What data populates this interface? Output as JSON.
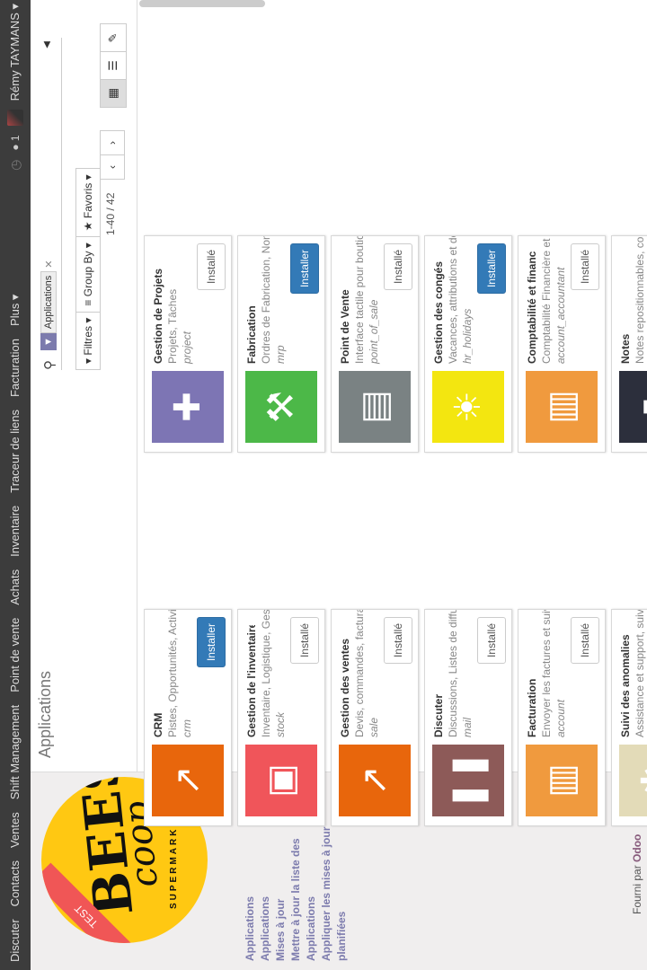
{
  "navbar": {
    "menu": [
      "Discuter",
      "Contacts",
      "Ventes",
      "Shift Management",
      "Point de vente",
      "Achats",
      "Inventaire",
      "Traceur de liens",
      "Facturation",
      "Plus ▾"
    ],
    "chat_count": "1",
    "user_name": "Rémy TAYMANS ▾"
  },
  "logo": {
    "brand": "BEES",
    "brand2": "coop",
    "tagline": "SUPERMARKET",
    "ribbon": "TEST"
  },
  "sidebar": {
    "links": [
      "Applications",
      "Applications",
      "Mises à jour",
      "Mettre à jour la liste des Applications",
      "Appliquer les mises à jour planifiées"
    ],
    "powered_prefix": "Fourni par",
    "powered_brand": "Odoo"
  },
  "control": {
    "breadcrumb": "Applications",
    "facet_value": "Applications",
    "filters_label": "Filtres ▾",
    "groupby_label": "Group By ▾",
    "favorites_label": "Favoris ▾",
    "pager": "1-40 / 42"
  },
  "colors": {
    "accent": "#7c7bad",
    "install_btn": "#337ab7",
    "navbar": "#3c3c3c"
  },
  "cards": [
    {
      "title": "CRM",
      "summary": "Pistes, Opportunités, Activités",
      "tech": "crm",
      "button": "Installer",
      "installed": false,
      "color": "#e8660c",
      "icon": "chart-icon"
    },
    {
      "title": "Gestion de Projets",
      "summary": "Projets, Tâches",
      "tech": "project",
      "button": "Installé",
      "installed": true,
      "color": "#7d75b4",
      "icon": "puzzle-icon"
    },
    {
      "title": "Gestion de l'inventaire",
      "summary": "Inventaire, Logistique, Gestion de stock",
      "tech": "stock",
      "button": "Installé",
      "installed": true,
      "color": "#f0555a",
      "icon": "box-icon"
    },
    {
      "title": "Fabrication",
      "summary": "Ordres de Fabrication, Nomenclatures, Gammes",
      "tech": "mrp",
      "button": "Installer",
      "installed": false,
      "color": "#4cb848",
      "icon": "wrench-icon"
    },
    {
      "title": "Gestion des ventes",
      "summary": "Devis, commandes, facturation",
      "tech": "sale",
      "button": "Installé",
      "installed": true,
      "color": "#e8660c",
      "icon": "chart-icon"
    },
    {
      "title": "Point de Vente",
      "summary": "Interface tactile pour boutiques",
      "tech": "point_of_sale",
      "button": "Installé",
      "installed": true,
      "color": "#7a8283",
      "icon": "register-icon"
    },
    {
      "title": "Discuter",
      "summary": "Discussions, Listes de diffusion, Nouvelles",
      "tech": "mail",
      "button": "Installé",
      "installed": true,
      "color": "#8d5a58",
      "icon": "chat-bubble-icon"
    },
    {
      "title": "Gestion des congés",
      "summary": "Vacances, attributions et demandes de congé",
      "tech": "hr_holidays",
      "button": "Installer",
      "installed": false,
      "color": "#f3e610",
      "icon": "sun-icon"
    },
    {
      "title": "Facturation",
      "summary": "Envoyer les factures et suivre les paiements",
      "tech": "account",
      "button": "Installé",
      "installed": true,
      "color": "#f09a3e",
      "icon": "invoice-icon"
    },
    {
      "title": "Comptabilité et finance",
      "summary": "Comptabilité Financière et Analytique",
      "tech": "account_accountant",
      "button": "Installé",
      "installed": true,
      "color": "#f09a3e",
      "icon": "invoice-icon"
    },
    {
      "title": "Suivi des anomalies",
      "summary": "Assistance et support, suivi des bogues",
      "tech": "",
      "button": "",
      "installed": false,
      "color": "#e3dbb8",
      "icon": "bug-icon"
    },
    {
      "title": "Notes",
      "summary": "Notes repositionnables, collaboratives, mémos",
      "tech": "",
      "button": "",
      "installed": false,
      "color": "#2c2f3c",
      "icon": "note-icon"
    }
  ]
}
